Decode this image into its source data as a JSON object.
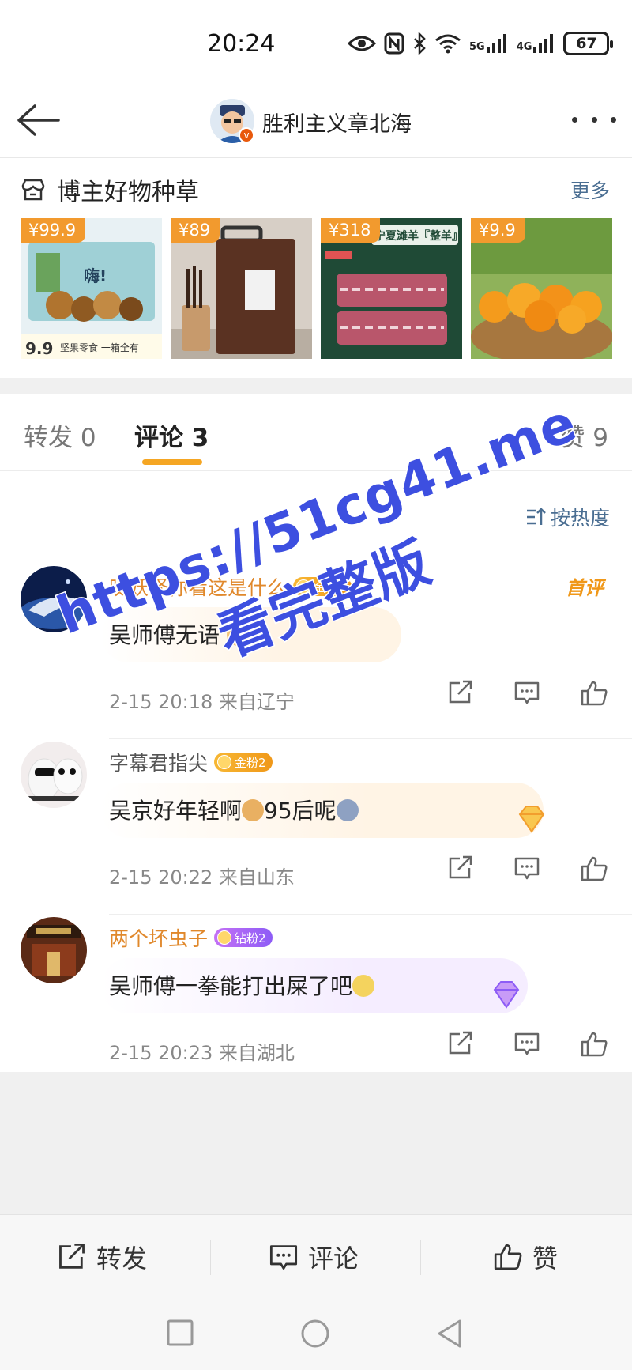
{
  "status_bar": {
    "time": "20:24",
    "battery": "67",
    "signal_labels": [
      "5G",
      "4G"
    ]
  },
  "header": {
    "title": "胜利主义章北海"
  },
  "goods": {
    "title": "博主好物种草",
    "more": "更多",
    "items": [
      {
        "price": "¥99.9",
        "image": "snack-box-image",
        "caption": "坚果零食 一箱全有"
      },
      {
        "price": "¥89",
        "image": "cutting-board-image",
        "caption": ""
      },
      {
        "price": "¥318",
        "image": "lamb-meat-image",
        "caption": "宁夏滩羊『整羊』"
      },
      {
        "price": "¥9.9",
        "image": "oranges-image",
        "caption": ""
      }
    ]
  },
  "tabs": [
    {
      "label": "转发 0",
      "active": false
    },
    {
      "label": "评论 3",
      "active": true
    },
    {
      "label": "赞 9",
      "active": false
    }
  ],
  "sort": {
    "label": "按热度"
  },
  "comments": [
    {
      "name": "呔妖怪你看这是什么",
      "badge": "金粉3",
      "text": "吴师傅无语",
      "time": "2-15 20:18",
      "location": "来自辽宁",
      "first_tag": "首评"
    },
    {
      "name": "字幕君指尖",
      "badge": "金粉2",
      "text": "吴京好年轻啊",
      "text2": "95后呢",
      "time": "2-15 20:22",
      "location": "来自山东"
    },
    {
      "name": "两个坏虫子",
      "badge": "钻粉2",
      "text": "吴师傅一拳能打出屎了吧",
      "time": "2-15 20:23",
      "location": "来自湖北"
    }
  ],
  "bottom_bar": {
    "repost": "转发",
    "comment": "评论",
    "like": "赞"
  },
  "watermark": {
    "line1": "https://51cg41.me",
    "line2": "看完整版"
  },
  "colors": {
    "accent": "#f5a623",
    "link": "#4a6e92",
    "name_gold": "#e0882b",
    "watermark": "#3d4fe0"
  }
}
